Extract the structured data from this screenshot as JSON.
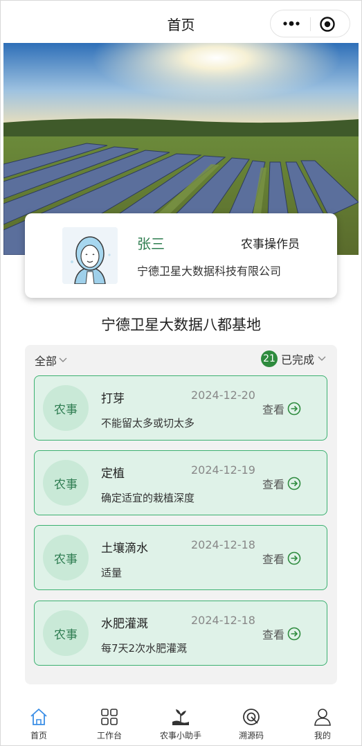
{
  "navbar": {
    "title": "首页",
    "more_icon": "more-dots-icon",
    "close_icon": "target-circle-icon"
  },
  "banner": {
    "image": "solar-farm-sunset-photo"
  },
  "user": {
    "name": "张三",
    "role": "农事操作员",
    "company": "宁德卫星大数据科技有限公司",
    "avatar_icon": "user-avatar-illustration"
  },
  "base": {
    "title": "宁德卫星大数据八都基地"
  },
  "filters": {
    "scope_label": "全部",
    "count": "21",
    "status_label": "已完成"
  },
  "tasks": [
    {
      "tag": "农事",
      "title": "打芽",
      "date": "2024-12-20",
      "desc": "不能留太多或切太多",
      "view_label": "查看"
    },
    {
      "tag": "农事",
      "title": "定植",
      "date": "2024-12-19",
      "desc": "确定适宜的栽植深度",
      "view_label": "查看"
    },
    {
      "tag": "农事",
      "title": "土壤滴水",
      "date": "2024-12-18",
      "desc": "适量",
      "view_label": "查看"
    },
    {
      "tag": "农事",
      "title": "水肥灌溉",
      "date": "2024-12-18",
      "desc": "每7天2次水肥灌溉",
      "view_label": "查看"
    }
  ],
  "tabbar": [
    {
      "label": "首页",
      "icon": "home-icon",
      "active": true
    },
    {
      "label": "工作台",
      "icon": "grid-icon",
      "active": false
    },
    {
      "label": "农事小助手",
      "icon": "plant-hand-icon",
      "active": false
    },
    {
      "label": "溯源码",
      "icon": "trace-code-icon",
      "active": false
    },
    {
      "label": "我的",
      "icon": "user-icon",
      "active": false
    }
  ],
  "colors": {
    "accent_green": "#2e8b3e",
    "task_bg": "#dff2e8",
    "task_border": "#3bb070",
    "home_active": "#3a8ee6"
  }
}
